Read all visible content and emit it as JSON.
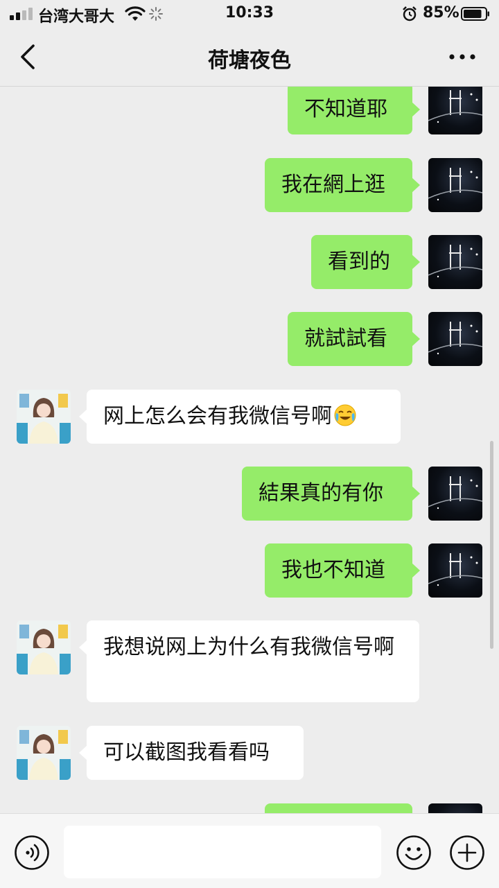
{
  "status_bar": {
    "carrier": "台湾大哥大",
    "time": "10:33",
    "battery_percent": "85%",
    "battery_level": 0.85
  },
  "nav": {
    "title": "荷塘夜色"
  },
  "messages": [
    {
      "sender": "me",
      "text": "不知道耶"
    },
    {
      "sender": "me",
      "text": "我在網上逛"
    },
    {
      "sender": "me",
      "text": "看到的"
    },
    {
      "sender": "me",
      "text": "就試試看"
    },
    {
      "sender": "contact",
      "text": "网上怎么会有我微信号啊",
      "emoji": "crying-laughing-emoji"
    },
    {
      "sender": "me",
      "text": "結果真的有你"
    },
    {
      "sender": "me",
      "text": "我也不知道"
    },
    {
      "sender": "contact",
      "text": "我想说网上为什么有我微信号啊"
    },
    {
      "sender": "contact",
      "text": "可以截图我看看吗"
    },
    {
      "sender": "me",
      "text": ""
    }
  ],
  "input": {
    "value": "",
    "placeholder": ""
  },
  "colors": {
    "outgoing_bubble": "#95ec69",
    "incoming_bubble": "#ffffff",
    "background": "#ededed"
  },
  "icons": {
    "back": "back-chevron-icon",
    "more": "more-dots-icon",
    "voice": "voice-input-icon",
    "emoji": "emoji-icon",
    "plus": "plus-icon"
  }
}
